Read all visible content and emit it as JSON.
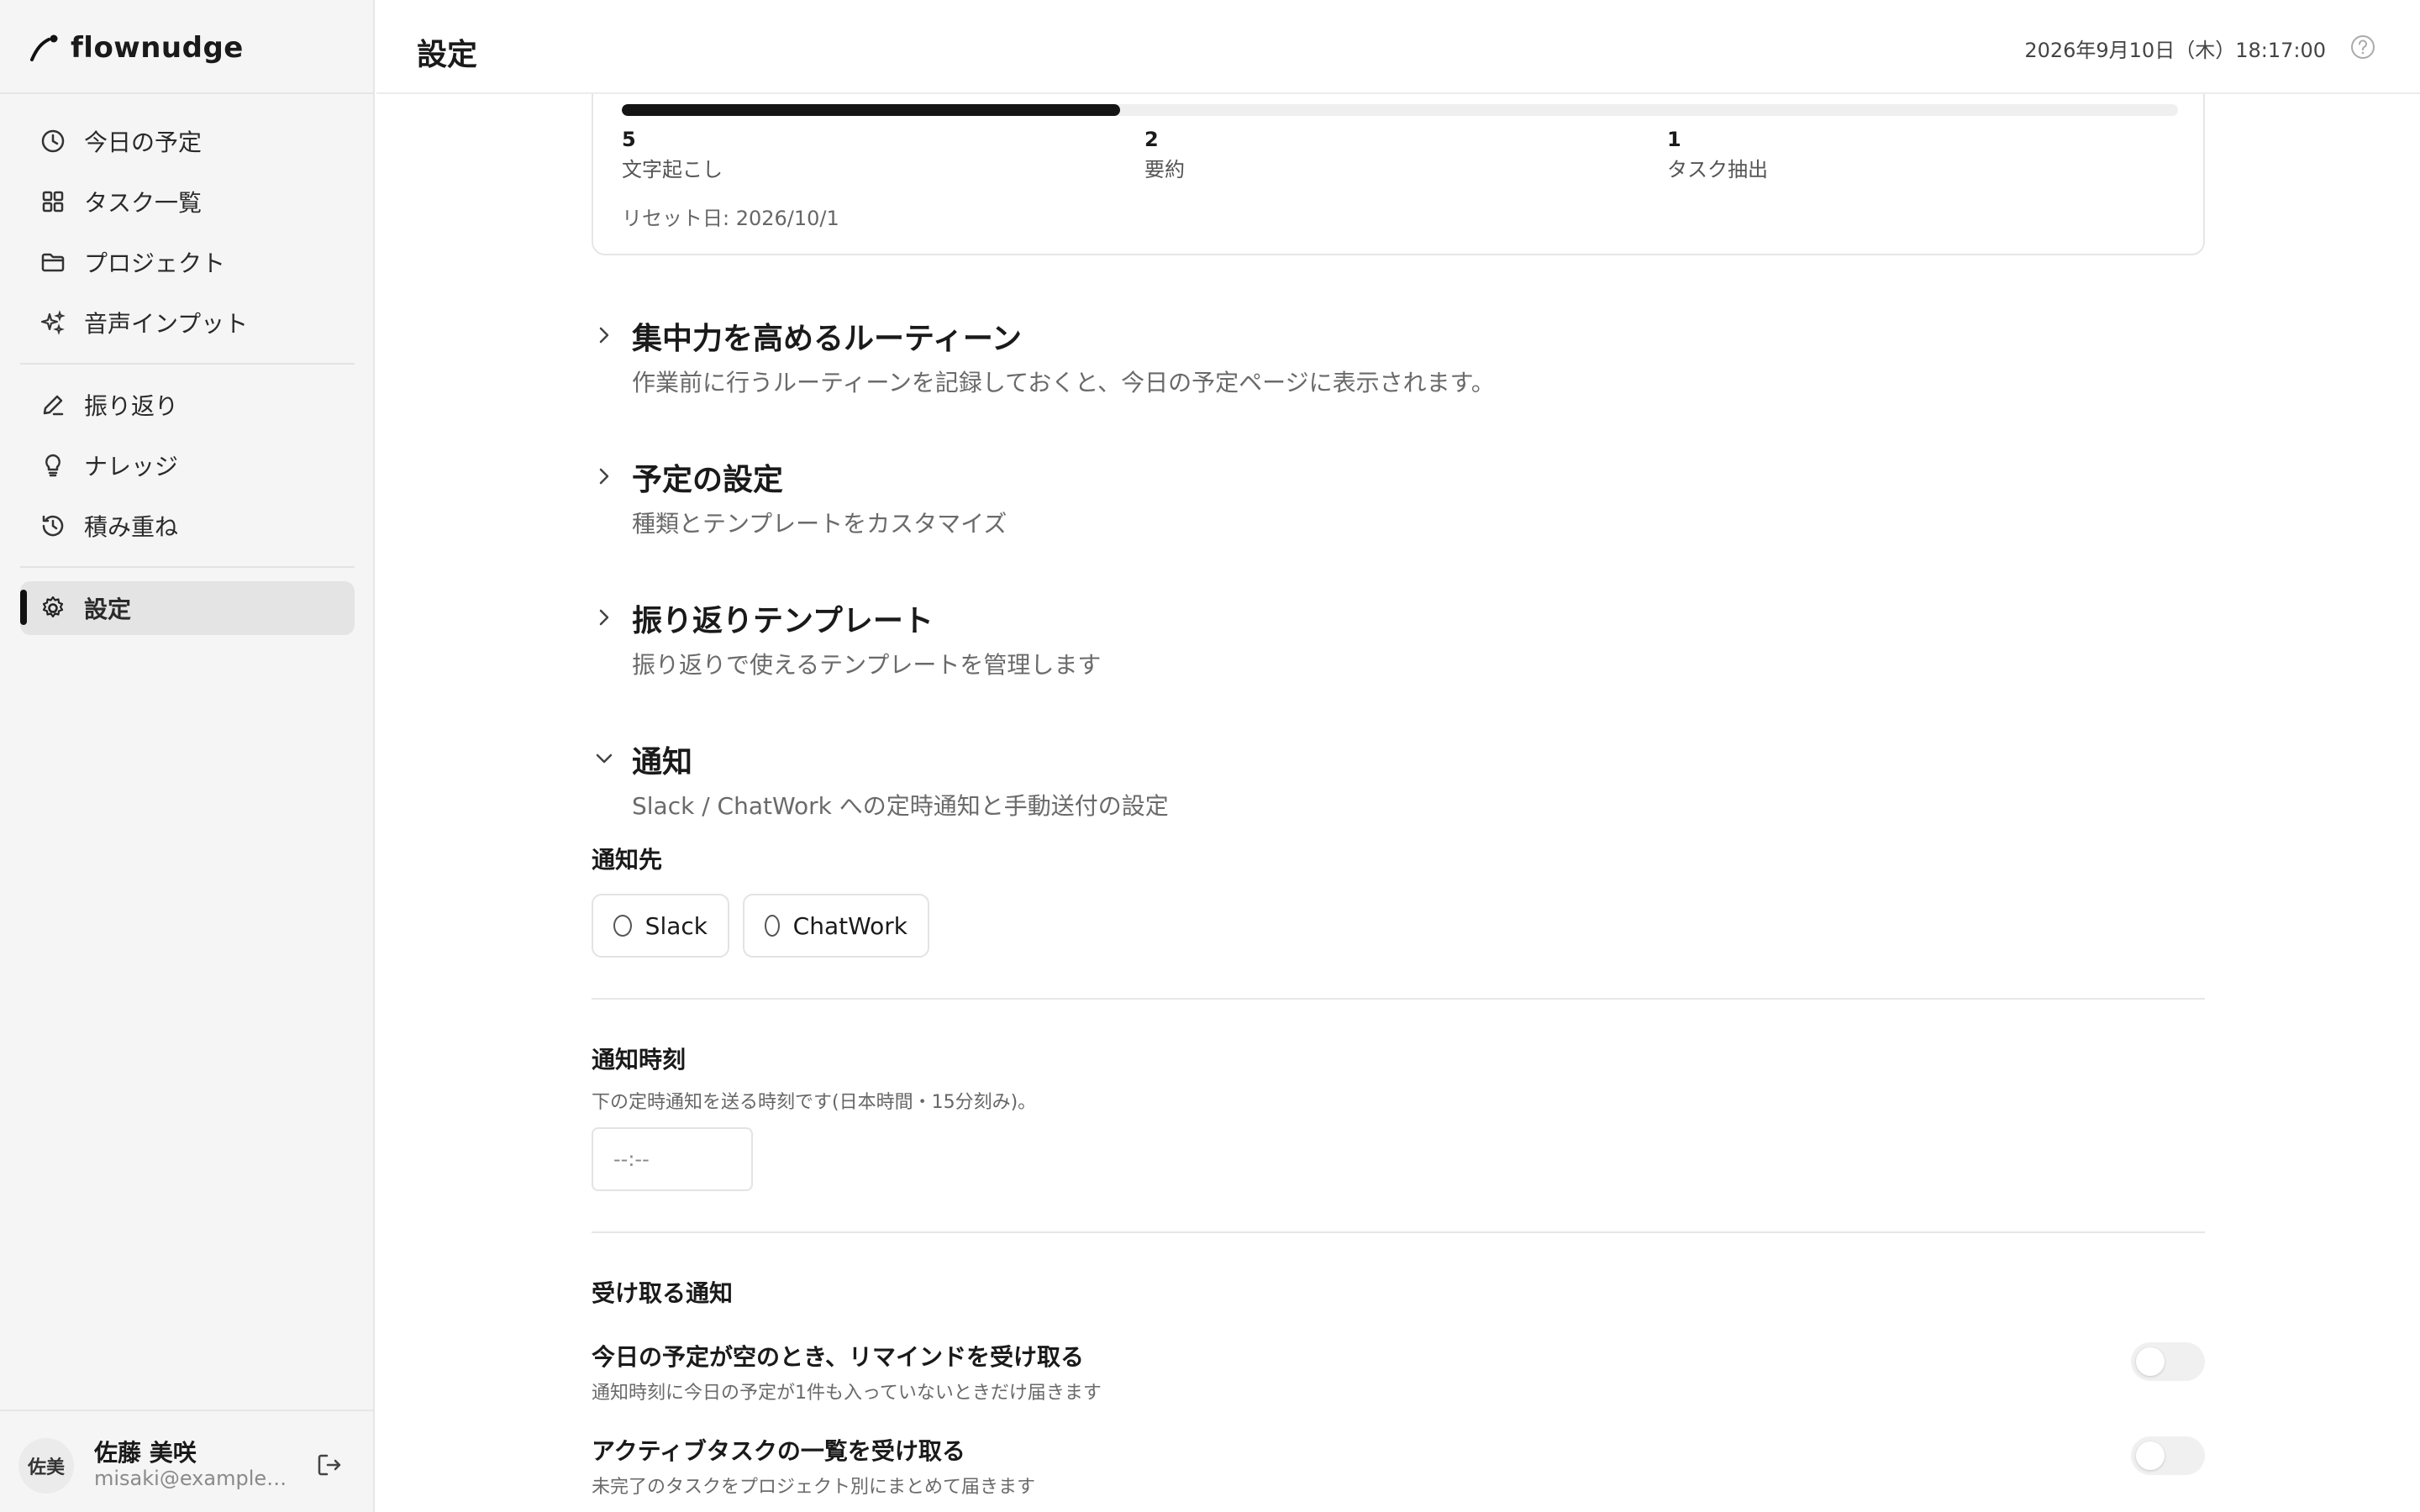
{
  "app": {
    "name": "flownudge"
  },
  "header": {
    "title": "設定",
    "datetime": "2026年9月10日（木）18:17:00"
  },
  "sidebar": {
    "items": [
      {
        "label": "今日の予定",
        "icon": "clock-icon"
      },
      {
        "label": "タスク一覧",
        "icon": "grid-icon"
      },
      {
        "label": "プロジェクト",
        "icon": "folder-icon"
      },
      {
        "label": "音声インプット",
        "icon": "sparkles-icon"
      },
      {
        "label": "振り返り",
        "icon": "pencil-icon"
      },
      {
        "label": "ナレッジ",
        "icon": "lightbulb-icon"
      },
      {
        "label": "積み重ね",
        "icon": "history-icon"
      },
      {
        "label": "設定",
        "icon": "gear-icon",
        "active": true
      }
    ]
  },
  "user": {
    "initials": "佐美",
    "name": "佐藤 美咲",
    "email": "misaki@example.…"
  },
  "usage": {
    "progress_fraction": 0.32,
    "stats": [
      {
        "value": "5",
        "label": "文字起こし"
      },
      {
        "value": "2",
        "label": "要約"
      },
      {
        "value": "1",
        "label": "タスク抽出"
      }
    ],
    "reset": "リセット日: 2026/10/1"
  },
  "sections": {
    "routine": {
      "title": "集中力を高めるルーティーン",
      "desc": "作業前に行うルーティーンを記録しておくと、今日の予定ページに表示されます。"
    },
    "schedule": {
      "title": "予定の設定",
      "desc": "種類とテンプレートをカスタマイズ"
    },
    "reflection": {
      "title": "振り返りテンプレート",
      "desc": "振り返りで使えるテンプレートを管理します"
    },
    "notify": {
      "title": "通知",
      "desc": "Slack / ChatWork への定時通知と手動送付の設定"
    }
  },
  "notify": {
    "dest_label": "通知先",
    "dest_options": [
      "Slack",
      "ChatWork"
    ],
    "time_label": "通知時刻",
    "time_desc": "下の定時通知を送る時刻です(日本時間・15分刻み)。",
    "time_placeholder": "--:--",
    "receive_label": "受け取る通知",
    "toggles": [
      {
        "title": "今日の予定が空のとき、リマインドを受け取る",
        "desc": "通知時刻に今日の予定が1件も入っていないときだけ届きます",
        "on": false
      },
      {
        "title": "アクティブタスクの一覧を受け取る",
        "desc": "未完了のタスクをプロジェクト別にまとめて届きます",
        "on": false
      }
    ]
  }
}
